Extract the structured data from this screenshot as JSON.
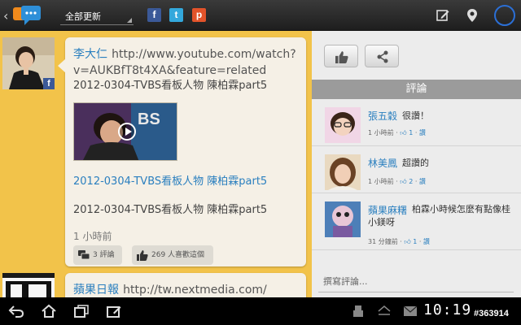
{
  "topbar": {
    "feed_label": "全部更新",
    "services": [
      {
        "name": "facebook",
        "glyph": "f",
        "color": "#3b5998"
      },
      {
        "name": "twitter",
        "glyph": "t",
        "color": "#33a8dc"
      },
      {
        "name": "plurk",
        "glyph": "p",
        "color": "#e2532a"
      }
    ]
  },
  "feed": {
    "post1": {
      "author": "李大仁",
      "url": "http://www.youtube.com/watch?v=AUKBfT8t4XA&feature=related",
      "title": "2012-0304-TVBS看板人物 陳柏霖part5",
      "video_title": "2012-0304-TVBS看板人物 陳柏霖part5",
      "description": "2012-0304-TVBS看板人物 陳柏霖part5",
      "time": "1 小時前",
      "comments_label": "3 評論",
      "likes_label": "269 人喜歡這個"
    },
    "post2": {
      "author": "蘋果日報",
      "url": "http://tw.nextmedia.com/"
    }
  },
  "panel": {
    "header": "評論",
    "compose_placeholder": "撰寫評論...",
    "comments": [
      {
        "name": "張五穀",
        "text": "很讚！",
        "time": "1 小時前",
        "likes": "1",
        "like_label": "讚"
      },
      {
        "name": "林美鳳",
        "text": "超讚的",
        "time": "1 小時前",
        "likes": "2",
        "like_label": "讚"
      },
      {
        "name": "蘋果麻糬",
        "text": "柏霖小時候怎麼有點像桂小鎂呀",
        "time": "31 分鐘前",
        "likes": "1",
        "like_label": "讚"
      }
    ]
  },
  "sysbar": {
    "clock": "10:19",
    "watermark": "#363914"
  }
}
